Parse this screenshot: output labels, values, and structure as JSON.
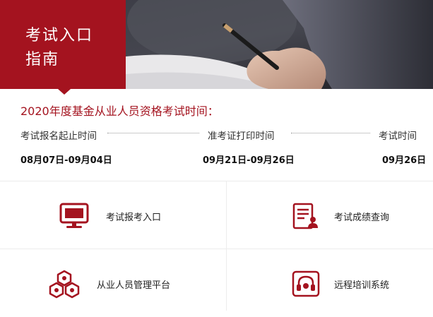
{
  "guide": {
    "line1": "考试入口",
    "line2": "指南"
  },
  "schedule": {
    "title": "2020年度基金从业人员资格考试时间：",
    "steps": [
      {
        "label": "考试报名起止时间",
        "date": "08月07日-09月04日"
      },
      {
        "label": "准考证打印时间",
        "date": "09月21日-09月26日"
      },
      {
        "label": "考试时间",
        "date": "09月26日"
      }
    ]
  },
  "links": [
    {
      "label": "考试报考入口",
      "icon": "monitor-icon"
    },
    {
      "label": "考试成绩查询",
      "icon": "score-report-icon"
    },
    {
      "label": "从业人员管理平台",
      "icon": "cubes-icon"
    },
    {
      "label": "远程培训系统",
      "icon": "remote-training-icon"
    }
  ],
  "colors": {
    "brand_red": "#a4131f",
    "grid_line": "#ececec"
  }
}
